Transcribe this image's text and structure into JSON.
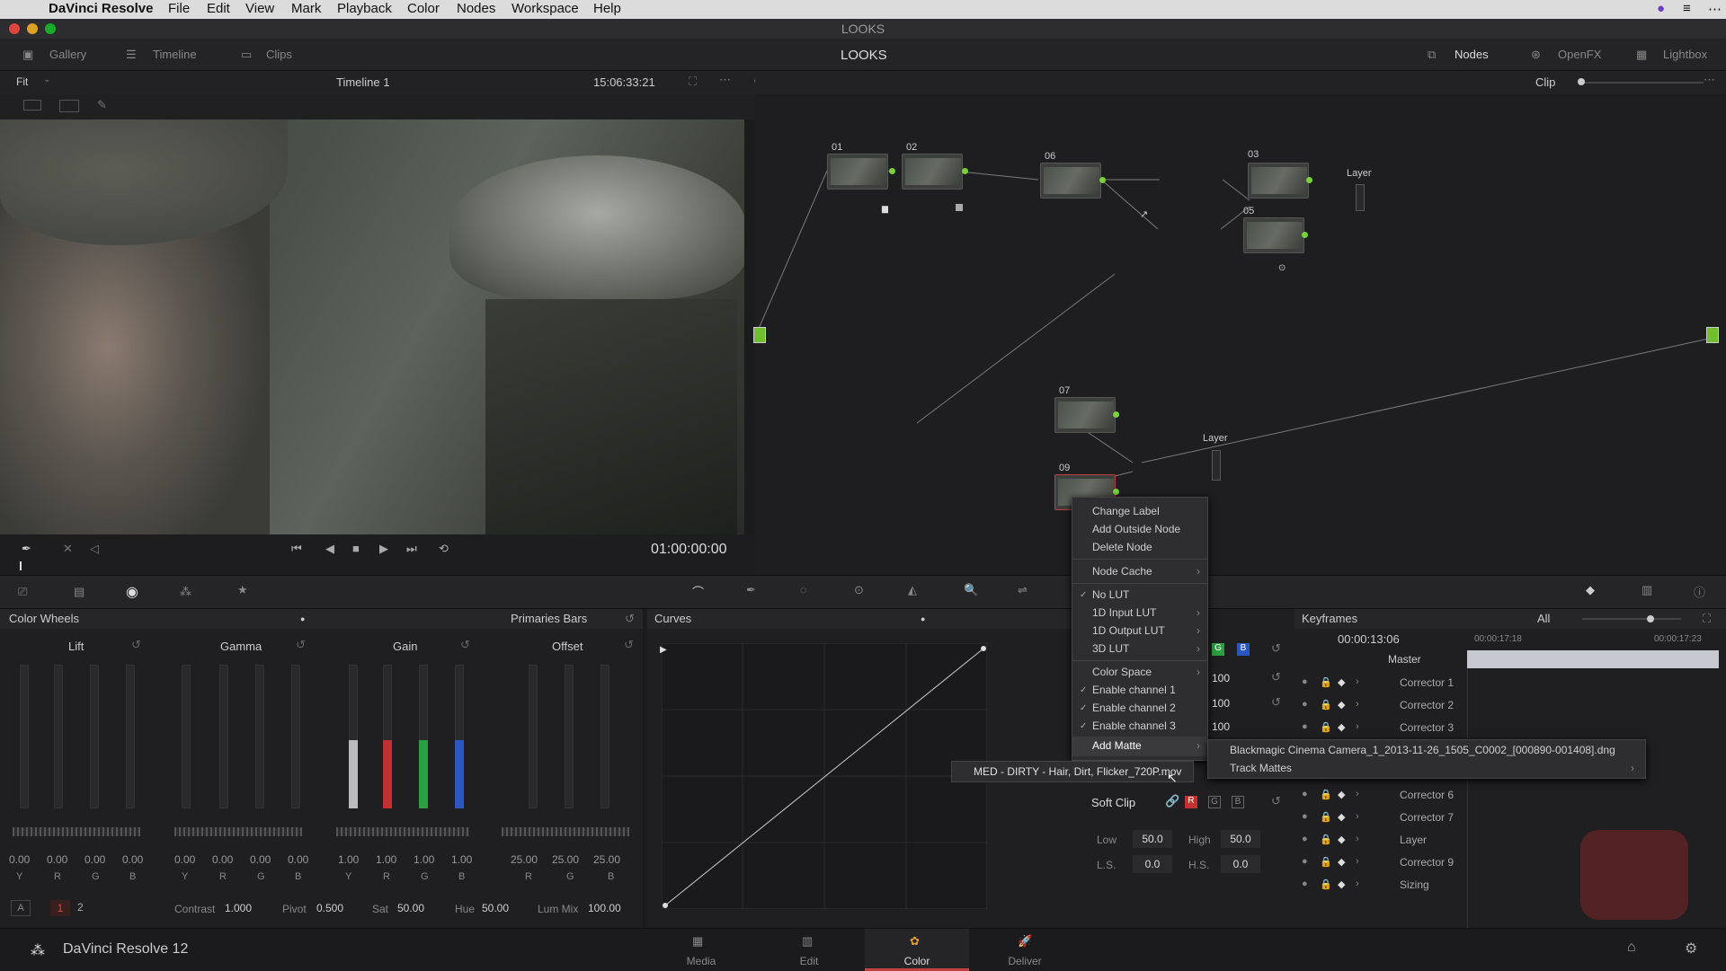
{
  "menubar": {
    "app": "DaVinci Resolve",
    "items": [
      "File",
      "Edit",
      "View",
      "Mark",
      "Playback",
      "Color",
      "Nodes",
      "Workspace",
      "Help"
    ]
  },
  "window_title": "LOOKS",
  "topbar": {
    "gallery": "Gallery",
    "timeline": "Timeline",
    "clips": "Clips",
    "title": "LOOKS",
    "nodes": "Nodes",
    "openfx": "OpenFX",
    "lightbox": "Lightbox"
  },
  "viewer": {
    "fit": "Fit",
    "timeline_name": "Timeline 1",
    "timecode": "15:06:33:21",
    "playhead_tc": "01:00:00:00"
  },
  "nodegraph": {
    "clip_label": "Clip",
    "nodes": [
      "01",
      "02",
      "06",
      "03",
      "05",
      "07",
      "09"
    ],
    "layer1": "Layer",
    "layer2": "Layer"
  },
  "context_menu": {
    "items": [
      "Change Label",
      "Add Outside Node",
      "Delete Node",
      "Node Cache",
      "No LUT",
      "1D Input LUT",
      "1D Output LUT",
      "3D LUT",
      "Color Space",
      "Enable channel 1",
      "Enable channel 2",
      "Enable channel 3",
      "Add Matte"
    ],
    "submenu": [
      "Blackmagic Cinema Camera_1_2013-11-26_1505_C0002_[000890-001408].dng",
      "Track Mattes"
    ],
    "hover_item": "MED - DIRTY - Hair, Dirt, Flicker_720P.mov"
  },
  "color_wheels": {
    "title": "Color Wheels",
    "mode": "Primaries Bars",
    "wheels": [
      {
        "name": "Lift",
        "values": [
          "0.00",
          "0.00",
          "0.00",
          "0.00"
        ],
        "channels": [
          "Y",
          "R",
          "G",
          "B"
        ]
      },
      {
        "name": "Gamma",
        "values": [
          "0.00",
          "0.00",
          "0.00",
          "0.00"
        ],
        "channels": [
          "Y",
          "R",
          "G",
          "B"
        ]
      },
      {
        "name": "Gain",
        "values": [
          "1.00",
          "1.00",
          "1.00",
          "1.00"
        ],
        "channels": [
          "Y",
          "R",
          "G",
          "B"
        ]
      },
      {
        "name": "Offset",
        "values": [
          "25.00",
          "25.00",
          "25.00"
        ],
        "channels": [
          "R",
          "G",
          "B"
        ]
      }
    ],
    "bottom": {
      "a": "A",
      "p1": "1",
      "p2": "2",
      "contrast_label": "Contrast",
      "contrast": "1.000",
      "pivot_label": "Pivot",
      "pivot": "0.500",
      "sat_label": "Sat",
      "sat": "50.00",
      "hue_label": "Hue",
      "hue": "50.00",
      "lummix_label": "Lum Mix",
      "lummix": "100.00"
    }
  },
  "curves": {
    "title": "Curves"
  },
  "rgbmix": {
    "v1": "100",
    "v2": "100",
    "v3": "100",
    "softclip": "Soft Clip",
    "low_label": "Low",
    "low": "50.0",
    "high_label": "High",
    "high": "50.0",
    "ls_label": "L.S.",
    "ls": "0.0",
    "hs_label": "H.S.",
    "hs": "0.0"
  },
  "keyframes": {
    "title": "Keyframes",
    "filter": "All",
    "tc_current": "00:00:13:06",
    "tc1": "00:00:17:18",
    "tc2": "00:00:17:23",
    "rows": [
      "Master",
      "Corrector 1",
      "Corrector 2",
      "Corrector 3",
      "Corrector 6",
      "Corrector 7",
      "Layer",
      "Corrector 9",
      "Sizing"
    ]
  },
  "bottom": {
    "brand": "DaVinci Resolve 12",
    "tabs": [
      "Media",
      "Edit",
      "Color",
      "Deliver"
    ],
    "active": "Color"
  },
  "colors": {
    "accent_green": "#7ad13b",
    "active_tab": "#c04040"
  }
}
